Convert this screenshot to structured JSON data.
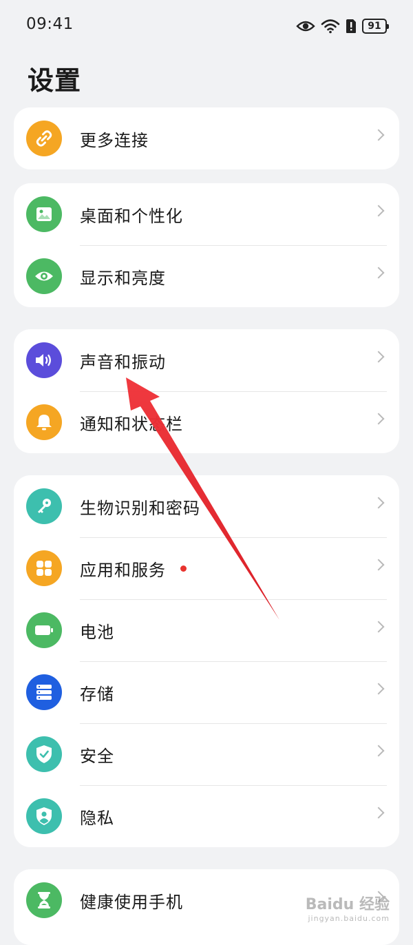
{
  "status_bar": {
    "time": "09:41",
    "battery_level": "91"
  },
  "page": {
    "title": "设置"
  },
  "cards": [
    {
      "items": [
        {
          "label": "更多连接",
          "icon": "link-icon",
          "color": "#f5a623"
        }
      ]
    },
    {
      "items": [
        {
          "label": "桌面和个性化",
          "icon": "image-icon",
          "color": "#4cb963"
        },
        {
          "label": "显示和亮度",
          "icon": "eye-icon",
          "color": "#4cb963"
        }
      ]
    },
    {
      "items": [
        {
          "label": "声音和振动",
          "icon": "speaker-icon",
          "color": "#5b4ddb"
        },
        {
          "label": "通知和状态栏",
          "icon": "bell-icon",
          "color": "#f5a623"
        }
      ]
    },
    {
      "items": [
        {
          "label": "生物识别和密码",
          "icon": "key-icon",
          "color": "#3dbfae"
        },
        {
          "label": "应用和服务",
          "icon": "apps-icon",
          "color": "#f5a623",
          "badge_color": "#e8332e"
        },
        {
          "label": "电池",
          "icon": "battery-icon",
          "color": "#4cb963"
        },
        {
          "label": "存储",
          "icon": "storage-icon",
          "color": "#1f5fe0"
        },
        {
          "label": "安全",
          "icon": "shield-check-icon",
          "color": "#3dbfae"
        },
        {
          "label": "隐私",
          "icon": "privacy-shield-icon",
          "color": "#3dbfae"
        }
      ]
    },
    {
      "items": [
        {
          "label": "健康使用手机",
          "icon": "hourglass-icon",
          "color": "#4cb963"
        }
      ]
    }
  ],
  "watermark": {
    "main": "Baidu 经验",
    "sub": "jingyan.baidu.com"
  }
}
